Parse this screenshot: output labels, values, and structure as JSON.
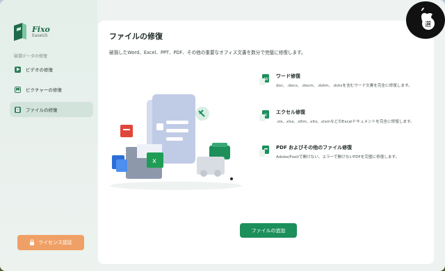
{
  "app": {
    "name": "Fixo",
    "vendor": "EaseUS"
  },
  "sidebar": {
    "section_label": "破損データの修復",
    "items": [
      {
        "label": "ビデオの修復",
        "icon": "play-icon"
      },
      {
        "label": "ピクチャーの修復",
        "icon": "image-icon"
      },
      {
        "label": "ファイルの修復",
        "icon": "file-icon",
        "active": true
      }
    ],
    "license_label": "ライセンス認証"
  },
  "main": {
    "title": "ファイルの修復",
    "description": "破損したWord、Excel、PPT、PDF、その他の重要なオフィス文書を数分で完璧に修復します。",
    "features": [
      {
        "title": "ワード修復",
        "body": "doc、.docx、.docm、.dotm、.dotxを含むワード文書を完全に修復します。",
        "icon": "word-icon"
      },
      {
        "title": "エクセル修復",
        "body": ".xls, .xlsx, .xltm, .xltx, .xlsmなどのExcelドキュメントを完全に修復します。",
        "icon": "excel-icon"
      },
      {
        "title": "PDF およびその他のファイル修復",
        "body": "Adobe/Foxitで開けない、エラーで開けないPDFを完璧に修復します。",
        "icon": "pdf-icon"
      }
    ],
    "add_button": "ファイルの追加"
  },
  "badge": {
    "text": "選"
  },
  "colors": {
    "accent": "#1c8f5a",
    "license": "#f0a066",
    "sidebar_active": "#d2e3dc"
  }
}
